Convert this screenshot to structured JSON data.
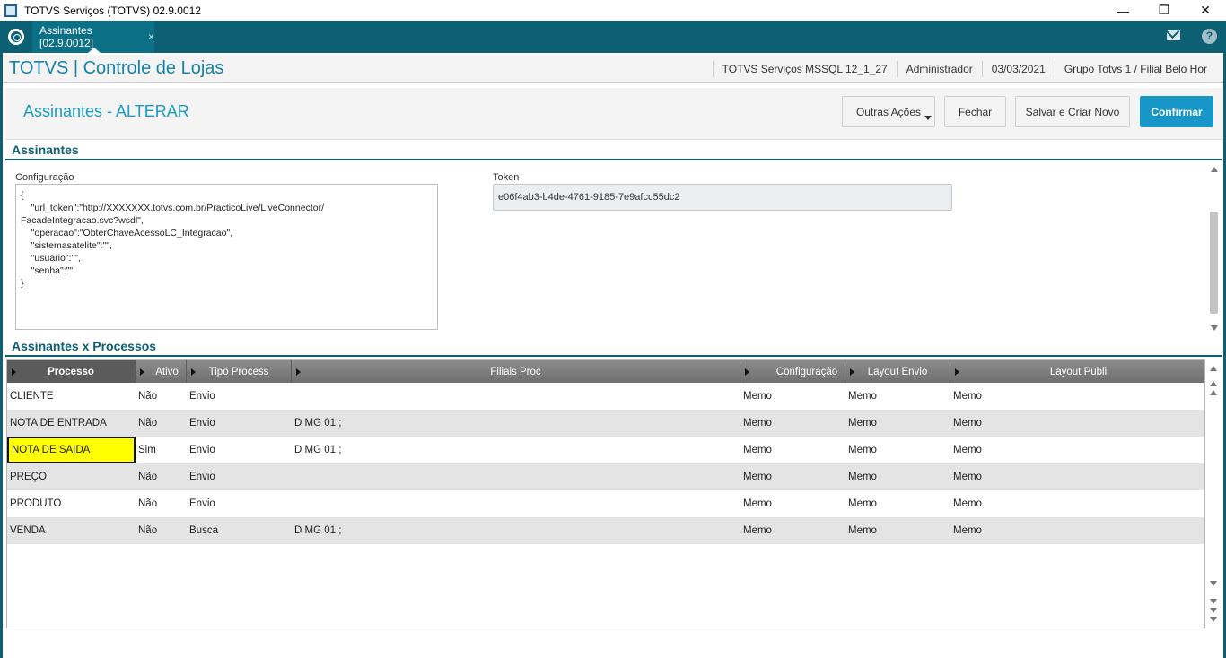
{
  "window": {
    "title": "TOTVS Serviços (TOTVS) 02.9.0012",
    "minimize": "—",
    "maximize": "❐",
    "close": "✕"
  },
  "tabbar": {
    "tab_label": "Assinantes [02.9.0012]",
    "tab_close": "×",
    "help": "?"
  },
  "app": {
    "title": "TOTVS | Controle de Lojas",
    "server": "TOTVS Serviços MSSQL 12_1_27",
    "user": "Administrador",
    "date": "03/03/2021",
    "branch": "Grupo Totvs 1 / Filial Belo Hor"
  },
  "form": {
    "title": "Assinantes - ALTERAR",
    "buttons": {
      "outras": "Outras Ações",
      "fechar": "Fechar",
      "salvar": "Salvar e Criar Novo",
      "confirmar": "Confirmar"
    }
  },
  "section1": {
    "title": "Assinantes",
    "config_label": "Configuração",
    "config_value": "{\n    \"url_token\":\"http://XXXXXXX.totvs.com.br/PracticoLive/LiveConnector/\nFacadeIntegracao.svc?wsdl\",\n    \"operacao\":\"ObterChaveAcessoLC_Integracao\",\n    \"sistemasatelite\":\"\",\n    \"usuario\":\"\",\n    \"senha\":\"\"\n}",
    "token_label": "Token",
    "token_value": "e06f4ab3-b4de-4761-9185-7e9afcc55dc2"
  },
  "section2": {
    "title": "Assinantes x Processos"
  },
  "grid": {
    "columns": [
      "Processo",
      "Ativo",
      "Tipo Process",
      "Filiais Proc",
      "Configuração",
      "Layout Envio",
      "Layout Publi"
    ],
    "rows": [
      [
        "CLIENTE",
        "Não",
        "Envio",
        "",
        "Memo",
        "Memo",
        "Memo"
      ],
      [
        "NOTA DE ENTRADA",
        "Não",
        "Envio",
        "D MG 01 ;",
        "Memo",
        "Memo",
        "Memo"
      ],
      [
        "NOTA DE SAIDA",
        "Sim",
        "Envio",
        "D MG 01 ;",
        "Memo",
        "Memo",
        "Memo"
      ],
      [
        "PREÇO",
        "Não",
        "Envio",
        "",
        "Memo",
        "Memo",
        "Memo"
      ],
      [
        "PRODUTO",
        "Não",
        "Envio",
        "",
        "Memo",
        "Memo",
        "Memo"
      ],
      [
        "VENDA",
        "Não",
        "Busca",
        "D MG 01 ;",
        "Memo",
        "Memo",
        "Memo"
      ]
    ],
    "focused_row": 2
  },
  "colors": {
    "teal": "#0d5f74",
    "accent": "#1797c7",
    "highlight": "#ffff00"
  },
  "icons": [
    "app-icon",
    "totvs-logo-icon",
    "mail-icon",
    "help-icon",
    "dropdown-caret-icon",
    "sort-triangle-icon"
  ]
}
